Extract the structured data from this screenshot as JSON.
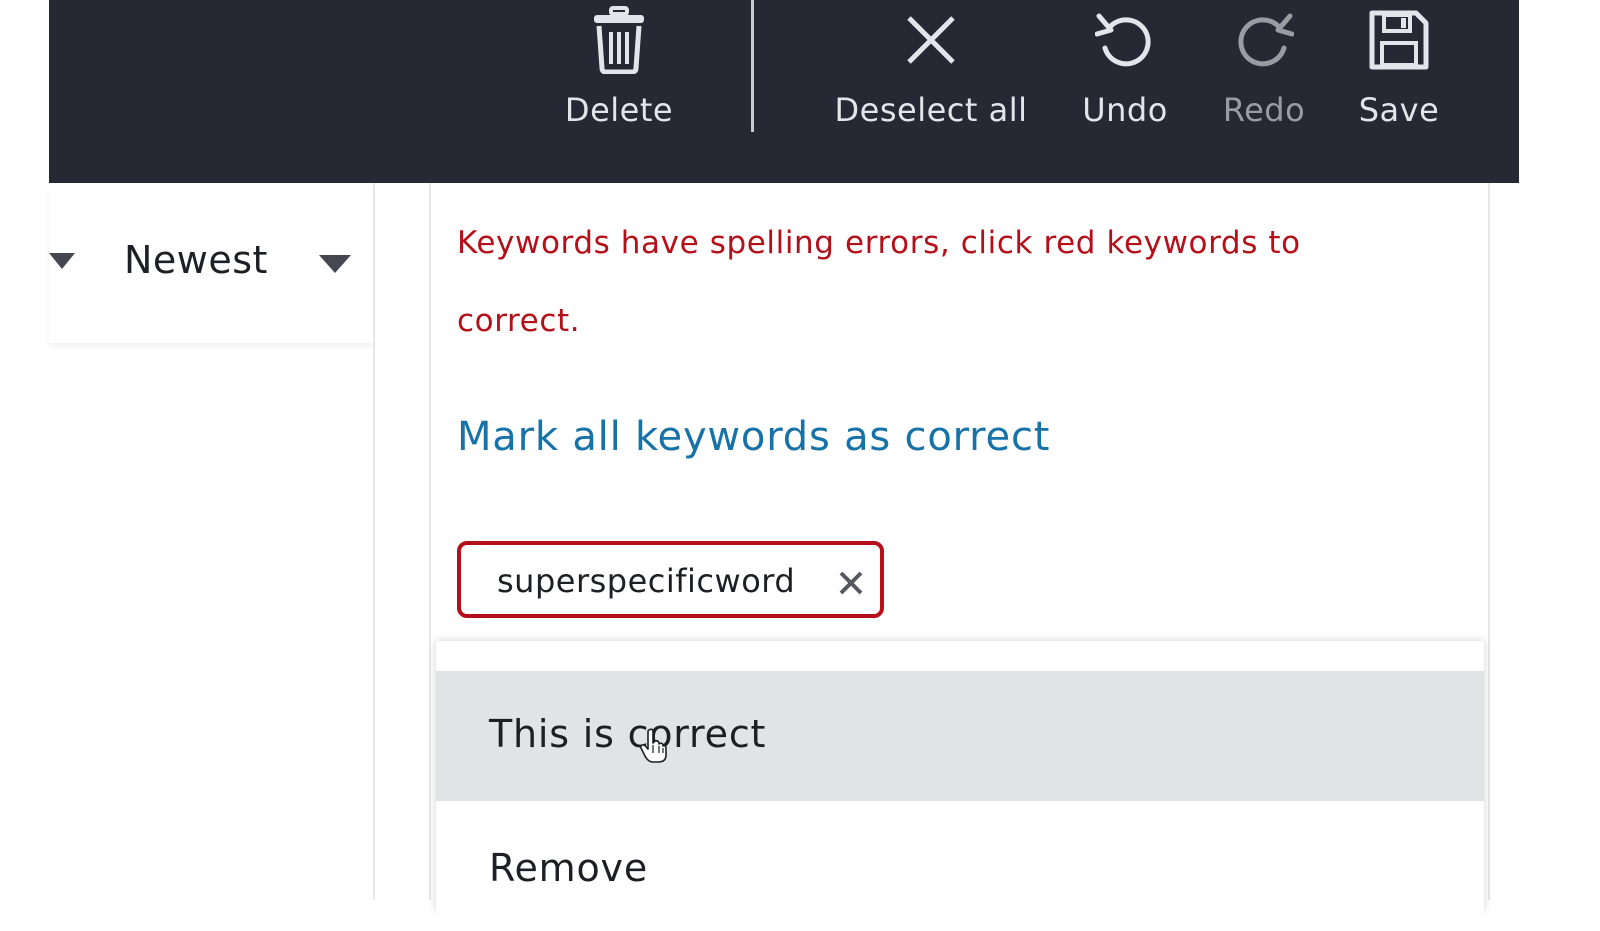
{
  "toolbar": {
    "delete_label": "Delete",
    "deselect_all_label": "Deselect all",
    "undo_label": "Undo",
    "redo_label": "Redo",
    "save_label": "Save",
    "icons": {
      "delete": "trash-icon",
      "deselect_all": "close-x-icon",
      "undo": "undo-icon",
      "redo": "redo-icon",
      "save": "floppy-disk-icon"
    },
    "redo_enabled": false
  },
  "sort": {
    "selected_value": "Newest"
  },
  "keywords": {
    "error_message": "Keywords have spelling errors, click red keywords to correct.",
    "mark_all_label": "Mark all keywords as correct",
    "chips": [
      {
        "label": "superspecificword",
        "misspelled": true
      }
    ]
  },
  "keyword_menu": {
    "items": [
      {
        "label": "This is correct",
        "hovered": true
      },
      {
        "label": "Remove",
        "hovered": false
      }
    ]
  },
  "colors": {
    "toolbar_bg": "#262934",
    "error_red": "#b5101a",
    "link_blue": "#1772a8",
    "hover_bg": "#e2e3e7"
  }
}
